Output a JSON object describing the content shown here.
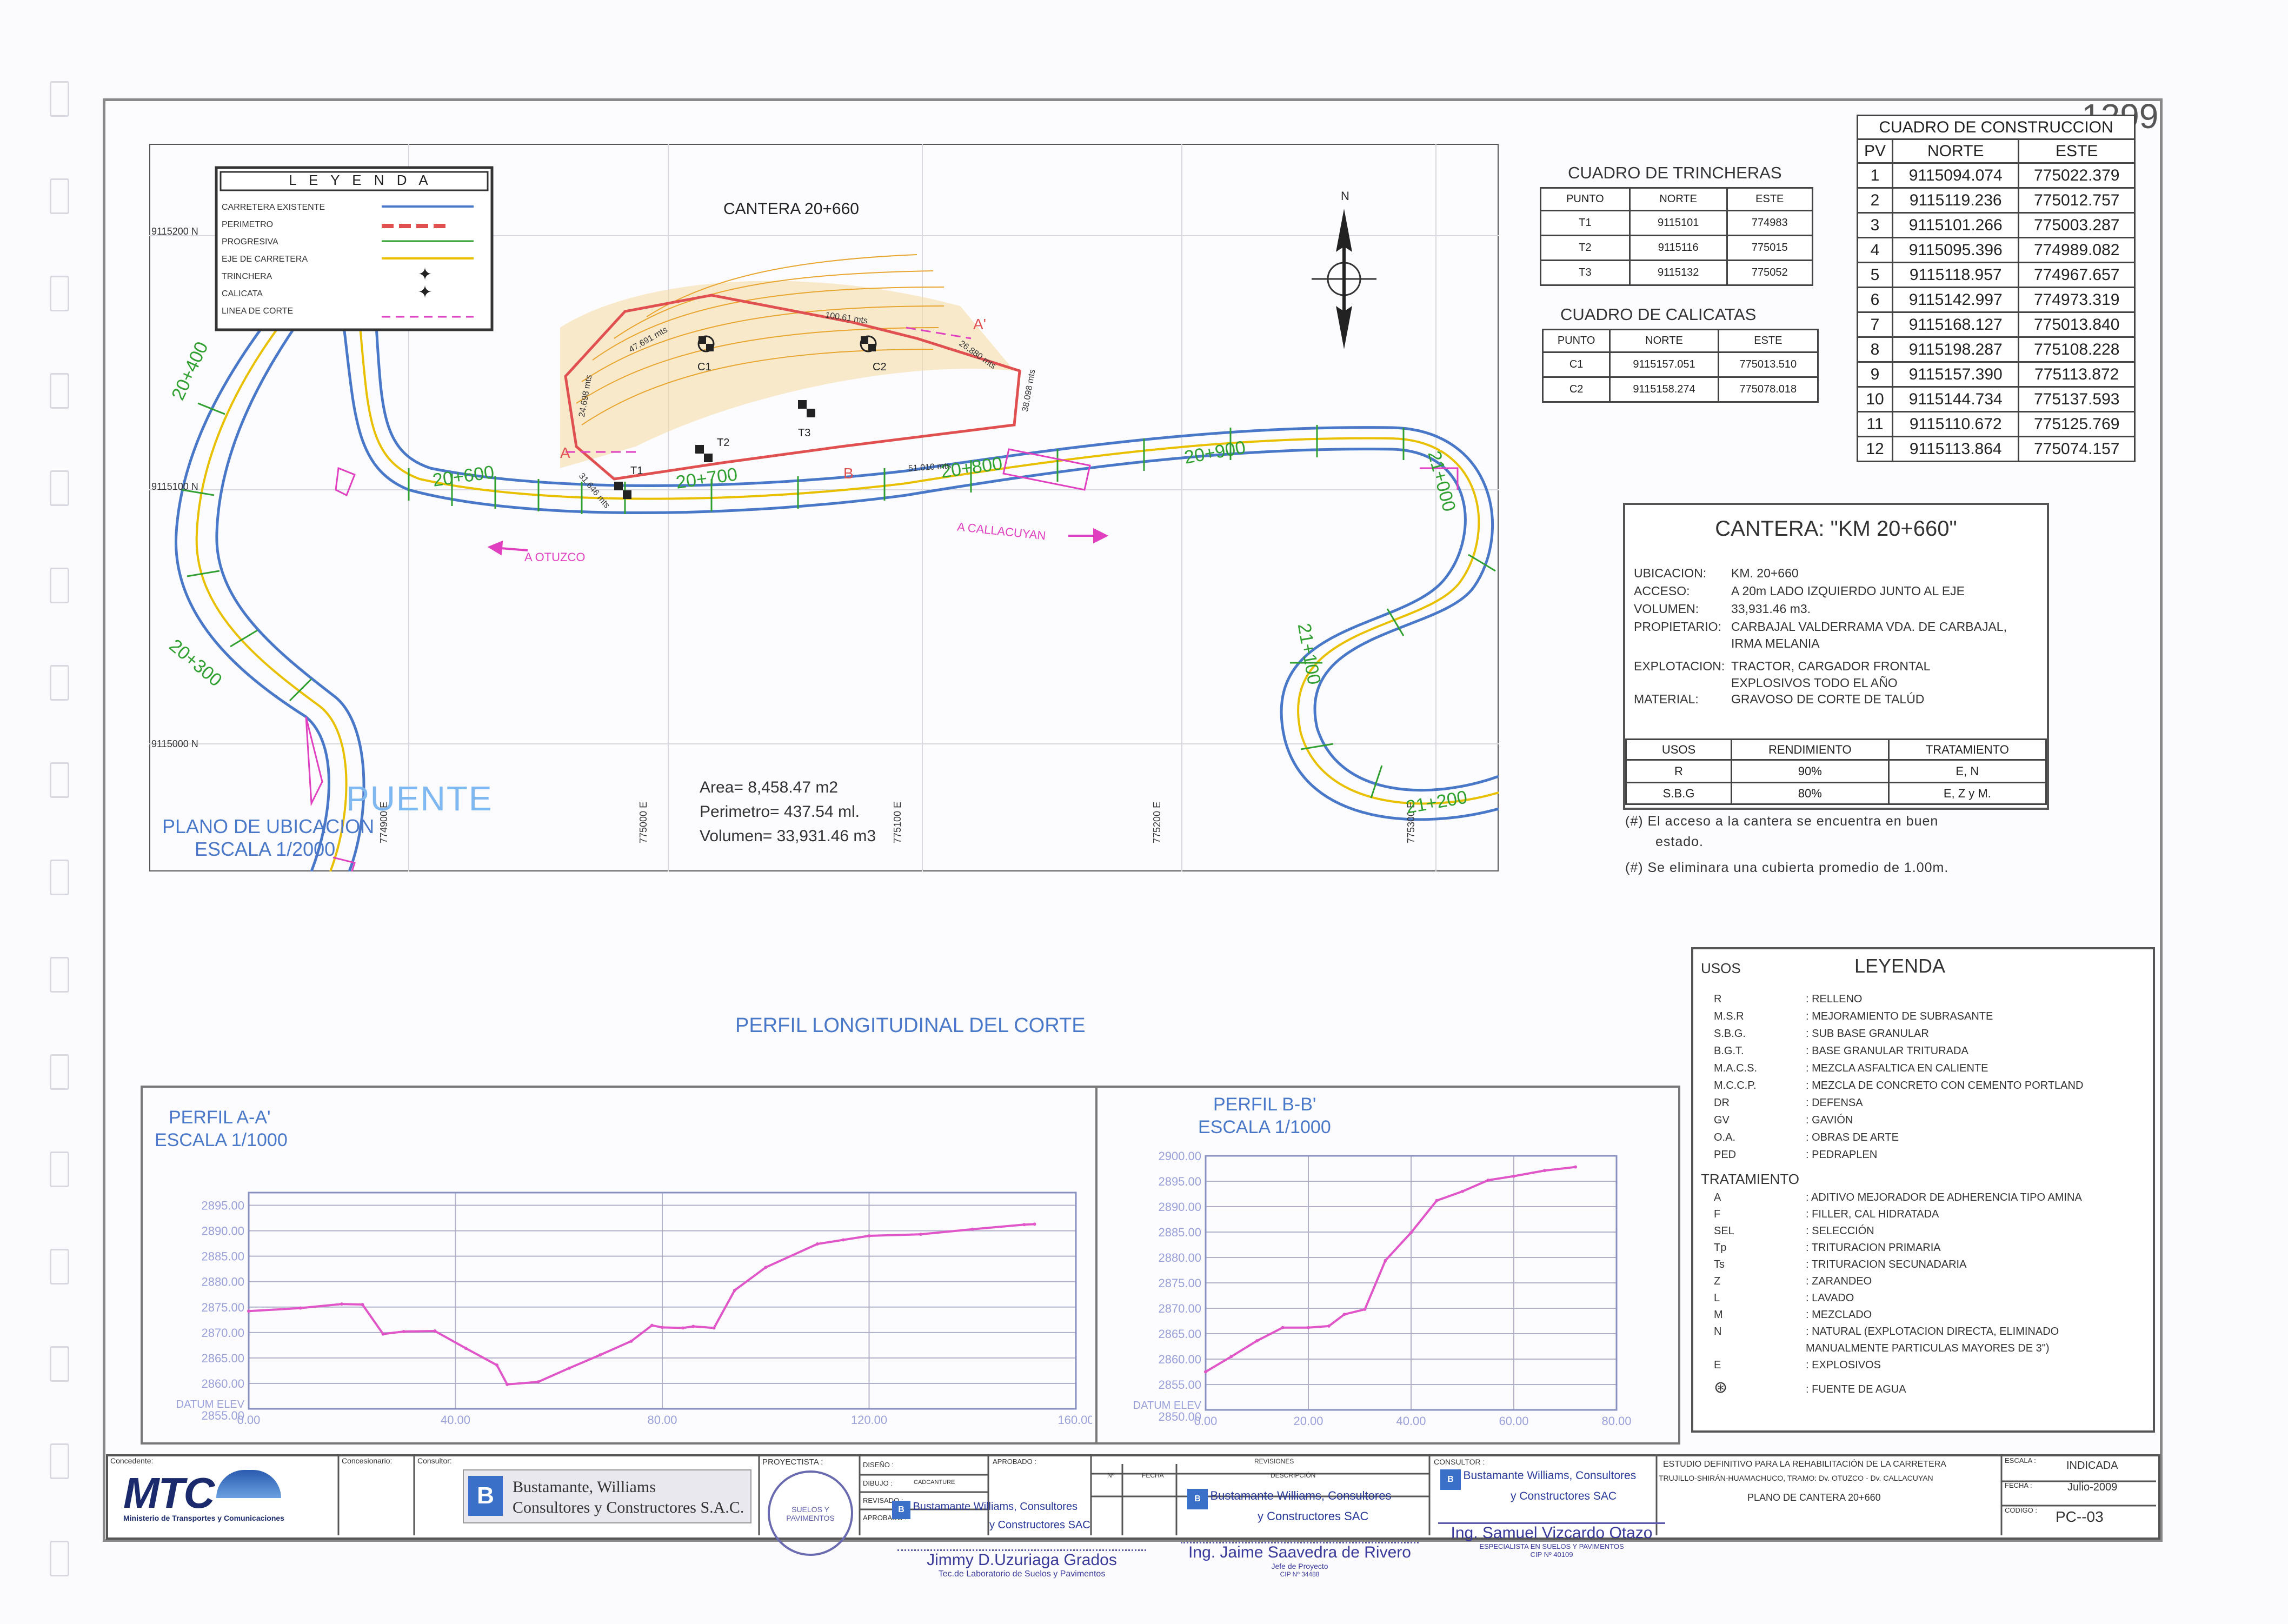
{
  "sheet_number": "1299",
  "map": {
    "title": "CANTERA 20+660",
    "north_label": "N",
    "legend_title": "L E Y E N D A",
    "legend_items": [
      {
        "label": "CARRETERA EXISTENTE",
        "kind": "line",
        "color": "#4a78c8"
      },
      {
        "label": "PERIMETRO",
        "kind": "dashed",
        "color": "#e05050"
      },
      {
        "label": "PROGRESIVA",
        "kind": "tick",
        "color": "#30a030"
      },
      {
        "label": "EJE DE CARRETERA",
        "kind": "line",
        "color": "#e8c000"
      },
      {
        "label": "TRINCHERA",
        "kind": "cross",
        "color": "#222222"
      },
      {
        "label": "CALICATA",
        "kind": "cross",
        "color": "#222222"
      },
      {
        "label": "LINEA DE CORTE",
        "kind": "dashed",
        "color": "#e040c0"
      }
    ],
    "northing_labels": [
      "9115200 N",
      "9115100 N",
      "9115000 N"
    ],
    "easting_labels": [
      "774900 E",
      "775000 E",
      "775100 E",
      "775200 E",
      "775300 E"
    ],
    "progressives": [
      "20+400",
      "20+600",
      "20+700",
      "20+800",
      "20+900",
      "21+000",
      "21+100",
      "21+200",
      "20+300"
    ],
    "direction_left": "A OTUZCO",
    "direction_right": "A CALLACUYAN",
    "puente": "PUENTE",
    "location_plan": "PLANO DE UBICACION",
    "location_scale": "ESCALA 1/2000",
    "area": "Area= 8,458.47 m2",
    "perimeter": "Perimetro= 437.54 ml.",
    "volume": "Volumen= 33,931.46 m3",
    "points": {
      "T1": "T1",
      "T2": "T2",
      "T3": "T3",
      "C1": "C1",
      "C2": "C2",
      "A": "A",
      "A2": "A'",
      "B": "B"
    },
    "dims": [
      "47.691 mts",
      "100.61 mts",
      "26.880 mts",
      "24.698 mts",
      "38.098 mts",
      "31.646 mts",
      "51.010 mts"
    ]
  },
  "trincheras": {
    "title": "CUADRO  DE  TRINCHERAS",
    "headers": [
      "PUNTO",
      "NORTE",
      "ESTE"
    ],
    "rows": [
      [
        "T1",
        "9115101",
        "774983"
      ],
      [
        "T2",
        "9115116",
        "775015"
      ],
      [
        "T3",
        "9115132",
        "775052"
      ]
    ]
  },
  "calicatas": {
    "title": "CUADRO  DE  CALICATAS",
    "headers": [
      "PUNTO",
      "NORTE",
      "ESTE"
    ],
    "rows": [
      [
        "C1",
        "9115157.051",
        "775013.510"
      ],
      [
        "C2",
        "9115158.274",
        "775078.018"
      ]
    ]
  },
  "construccion": {
    "title": "CUADRO DE CONSTRUCCION",
    "headers": [
      "PV",
      "NORTE",
      "ESTE"
    ],
    "rows": [
      [
        "1",
        "9115094.074",
        "775022.379"
      ],
      [
        "2",
        "9115119.236",
        "775012.757"
      ],
      [
        "3",
        "9115101.266",
        "775003.287"
      ],
      [
        "4",
        "9115095.396",
        "774989.082"
      ],
      [
        "5",
        "9115118.957",
        "774967.657"
      ],
      [
        "6",
        "9115142.997",
        "774973.319"
      ],
      [
        "7",
        "9115168.127",
        "775013.840"
      ],
      [
        "8",
        "9115198.287",
        "775108.228"
      ],
      [
        "9",
        "9115157.390",
        "775113.872"
      ],
      [
        "10",
        "9115144.734",
        "775137.593"
      ],
      [
        "11",
        "9115110.672",
        "775125.769"
      ],
      [
        "12",
        "9115113.864",
        "775074.157"
      ]
    ]
  },
  "cantera": {
    "title": "CANTERA:  \"KM 20+660\"",
    "fields": [
      {
        "k": "UBICACION:",
        "v": "KM. 20+660"
      },
      {
        "k": "ACCESO:",
        "v": "A 20m LADO IZQUIERDO JUNTO AL EJE"
      },
      {
        "k": "VOLUMEN:",
        "v": "33,931.46 m3."
      },
      {
        "k": "PROPIETARIO:",
        "v": "CARBAJAL VALDERRAMA VDA. DE CARBAJAL,"
      },
      {
        "k": "",
        "v": "IRMA MELANIA"
      },
      {
        "k": "EXPLOTACION:",
        "v": "TRACTOR, CARGADOR FRONTAL"
      },
      {
        "k": "",
        "v": "EXPLOSIVOS TODO EL AÑO"
      },
      {
        "k": "MATERIAL:",
        "v": "GRAVOSO DE CORTE DE TALÚD"
      }
    ],
    "uses_headers": [
      "USOS",
      "RENDIMIENTO",
      "TRATAMIENTO"
    ],
    "uses_rows": [
      [
        "R",
        "90%",
        "E, N"
      ],
      [
        "S.B.G",
        "80%",
        "E, Z y M."
      ]
    ],
    "notes": [
      "(#)  El acceso a la cantera se encuentra en buen",
      "estado.",
      "(#)  Se eliminara una cubierta promedio de 1.00m."
    ]
  },
  "leyenda": {
    "usos_label": "USOS",
    "title": "LEYENDA",
    "usos": [
      [
        "R",
        ": RELLENO"
      ],
      [
        "M.S.R",
        ": MEJORAMIENTO DE SUBRASANTE"
      ],
      [
        "S.B.G.",
        ": SUB BASE GRANULAR"
      ],
      [
        "B.G.T.",
        ": BASE GRANULAR TRITURADA"
      ],
      [
        "M.A.C.S.",
        ": MEZCLA ASFALTICA EN CALIENTE"
      ],
      [
        "M.C.C.P.",
        ": MEZCLA DE CONCRETO CON CEMENTO PORTLAND"
      ],
      [
        "DR",
        ": DEFENSA"
      ],
      [
        "GV",
        ": GAVIÓN"
      ],
      [
        "O.A.",
        ": OBRAS DE ARTE"
      ],
      [
        "PED",
        ": PEDRAPLEN"
      ]
    ],
    "tratamiento_label": "TRATAMIENTO",
    "tratamiento": [
      [
        "A",
        ": ADITIVO MEJORADOR DE ADHERENCIA TIPO AMINA"
      ],
      [
        "F",
        ": FILLER, CAL HIDRATADA"
      ],
      [
        "SEL",
        ": SELECCIÓN"
      ],
      [
        "Tp",
        ": TRITURACION PRIMARIA"
      ],
      [
        "Ts",
        ": TRITURACION SECUNADARIA"
      ],
      [
        "Z",
        ": ZARANDEO"
      ],
      [
        "L",
        ": LAVADO"
      ],
      [
        "M",
        ": MEZCLADO"
      ],
      [
        "N",
        ": NATURAL (EXPLOTACION DIRECTA, ELIMINADO"
      ],
      [
        "",
        "MANUALMENTE PARTICULAS MAYORES DE 3\")"
      ],
      [
        "E",
        ": EXPLOSIVOS"
      ],
      [
        "",
        ": FUENTE DE AGUA"
      ]
    ]
  },
  "profile_title": "PERFIL LONGITUDINAL DEL CORTE",
  "chart_data": [
    {
      "type": "line",
      "title": "PERFIL A-A'",
      "subtitle": "ESCALA 1/1000",
      "datum": "DATUM ELEV",
      "datum_value": "2855.00",
      "xlim": [
        0,
        160
      ],
      "ylim": [
        2855,
        2897.5
      ],
      "x_ticks": [
        0,
        40,
        80,
        120,
        160
      ],
      "x_tick_labels": [
        "0.00",
        "40.00",
        "80.00",
        "120.00",
        "160.00"
      ],
      "y_ticks": [
        2860,
        2865,
        2870,
        2875,
        2880,
        2885,
        2890,
        2895
      ],
      "y_tick_labels": [
        "2860.00",
        "2865.00",
        "2870.00",
        "2875.00",
        "2880.00",
        "2885.00",
        "2890.00",
        "2895.00"
      ],
      "x": [
        0,
        10,
        18,
        22,
        26,
        30,
        36,
        42,
        48,
        50,
        56,
        62,
        68,
        74,
        78,
        80,
        84,
        86,
        90,
        94,
        100,
        110,
        115,
        120,
        130,
        140,
        150,
        152
      ],
      "y": [
        2874.2,
        2874.8,
        2875.6,
        2875.5,
        2869.7,
        2870.2,
        2870.3,
        2866.9,
        2863.6,
        2859.8,
        2860.3,
        2863.0,
        2865.6,
        2868.3,
        2871.4,
        2871.0,
        2870.9,
        2871.2,
        2870.9,
        2878.3,
        2882.8,
        2887.4,
        2888.2,
        2889.0,
        2889.3,
        2890.3,
        2891.2,
        2891.3
      ]
    },
    {
      "type": "line",
      "title": "PERFIL B-B'",
      "subtitle": "ESCALA 1/1000",
      "datum": "DATUM ELEV",
      "datum_value": "2850.00",
      "xlim": [
        0,
        80
      ],
      "ylim": [
        2850,
        2900
      ],
      "x_ticks": [
        0,
        20,
        40,
        60,
        80
      ],
      "x_tick_labels": [
        "0.00",
        "20.00",
        "40.00",
        "60.00",
        "80.00"
      ],
      "y_ticks": [
        2855,
        2860,
        2865,
        2870,
        2875,
        2880,
        2885,
        2890,
        2895,
        2900
      ],
      "y_tick_labels": [
        "2855.00",
        "2860.00",
        "2865.00",
        "2870.00",
        "2875.00",
        "2880.00",
        "2885.00",
        "2890.00",
        "2895.00",
        "2900.00"
      ],
      "x": [
        0,
        5,
        10,
        15,
        20,
        24,
        27,
        31,
        35,
        40,
        45,
        50,
        55,
        60,
        66,
        72
      ],
      "y": [
        2857.5,
        2860.5,
        2863.6,
        2866.2,
        2866.2,
        2866.5,
        2868.8,
        2869.8,
        2879.4,
        2884.9,
        2891.2,
        2893.0,
        2895.2,
        2896.0,
        2897.1,
        2897.8
      ]
    }
  ],
  "title_block": {
    "concedente_label": "Concedente:",
    "concesionario_label": "Concesionario:",
    "consultor_label": "Consultor:",
    "mtc_logo": "MTC",
    "mtc_sub": "Ministerio de Transportes y Comunicaciones",
    "bw_name1": "Bustamante, Williams",
    "bw_name2": "Consultores y Constructores S.A.C.",
    "proyectista_label": "PROYECTISTA :",
    "diseno_label": "DISEÑO :",
    "dibujo_label": "DIBUJO :",
    "dibujo_value": "CADCANTURE",
    "revisado_label": "REVISADO :",
    "aprobado_label": "APROBADO :",
    "aprobado_header": "APROBADO :",
    "rev_headers": [
      "Nº",
      "FECHA",
      "REVISIONES",
      "DESCRIPCIÓN"
    ],
    "consultor_label2": "CONSULTOR :",
    "stamp_bw1": "Bustamante Williams, Consultores",
    "stamp_bw2": "y Constructores SAC",
    "estudio": "ESTUDIO DEFINITIVO PARA LA REHABILITACIÓN DE LA CARRETERA",
    "tramo": "TRUJILLO-SHIRÁN-HUAMACHUCO, TRAMO: Dv. OTUZCO - Dv. CALLACUYAN",
    "plano": "PLANO DE CANTERA 20+660",
    "escala_label": "ESCALA :",
    "escala": "INDICADA",
    "fecha_label": "FECHA :",
    "fecha": "Julio-2009",
    "codigo_label": "CODIGO :",
    "codigo": "PC--03",
    "sig1_name": "Jimmy D.Uzuriaga Grados",
    "sig1_role": "Tec.de Laboratorio de Suelos y Pavimentos",
    "sig2_name": "Ing. Jaime Saavedra de Rivero",
    "sig2_role": "Jefe de Proyecto",
    "sig2_cip": "CIP Nº 34488",
    "sig3_name": "Ing. Samuel Vizcardo Otazo",
    "sig3_role": "ESPECIALISTA EN SUELOS Y PAVIMENTOS",
    "sig3_cip": "CIP Nº 40109",
    "seal_text": "SUELOS Y PAVIMENTOS"
  }
}
